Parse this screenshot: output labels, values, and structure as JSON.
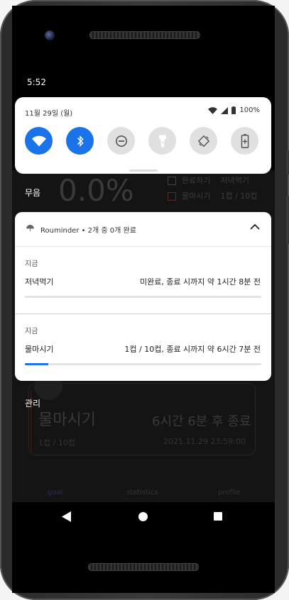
{
  "status_bar": {
    "time": "5:52"
  },
  "quick_settings": {
    "date": "11월 29일 (월)",
    "battery": "100%",
    "tiles": [
      {
        "name": "wifi",
        "icon": "wifi-icon",
        "on": true
      },
      {
        "name": "bluetooth",
        "icon": "bluetooth-icon",
        "on": true
      },
      {
        "name": "do-not-disturb",
        "icon": "dnd-icon",
        "on": false
      },
      {
        "name": "flashlight",
        "icon": "flashlight-icon",
        "on": false
      },
      {
        "name": "auto-rotate",
        "icon": "rotate-icon",
        "on": false
      },
      {
        "name": "battery-saver",
        "icon": "battery-saver-icon",
        "on": false
      }
    ]
  },
  "sections": {
    "silent": "무음",
    "manage": "관리"
  },
  "background_app": {
    "big_value": "0.0%",
    "legend": [
      {
        "label": "완료하기",
        "value": "저녁먹기"
      },
      {
        "label": "물마시기",
        "value": "1컵 / 10컵"
      }
    ],
    "task_title": "물마시기",
    "remaining": "6시간 6분 후 종료",
    "count": "1컵 / 10컵",
    "date": "2021.11.29 23:59:00",
    "nav": [
      "goal",
      "statistics",
      "profile"
    ]
  },
  "notification": {
    "app_line": "Rouminder • 2개 중 0개 완료",
    "items": [
      {
        "when": "지금",
        "title": "저녁먹기",
        "text": "미완료, 종료 시까지 약 1시간 8분 전",
        "progress": 0
      },
      {
        "when": "지금",
        "title": "물마시기",
        "text": "1컵 / 10컵, 종료 시까지 약 6시간 7분 전",
        "progress": 0.1
      }
    ]
  },
  "colors": {
    "accent": "#1a73e8",
    "tile_off": "#e0e0e0"
  }
}
